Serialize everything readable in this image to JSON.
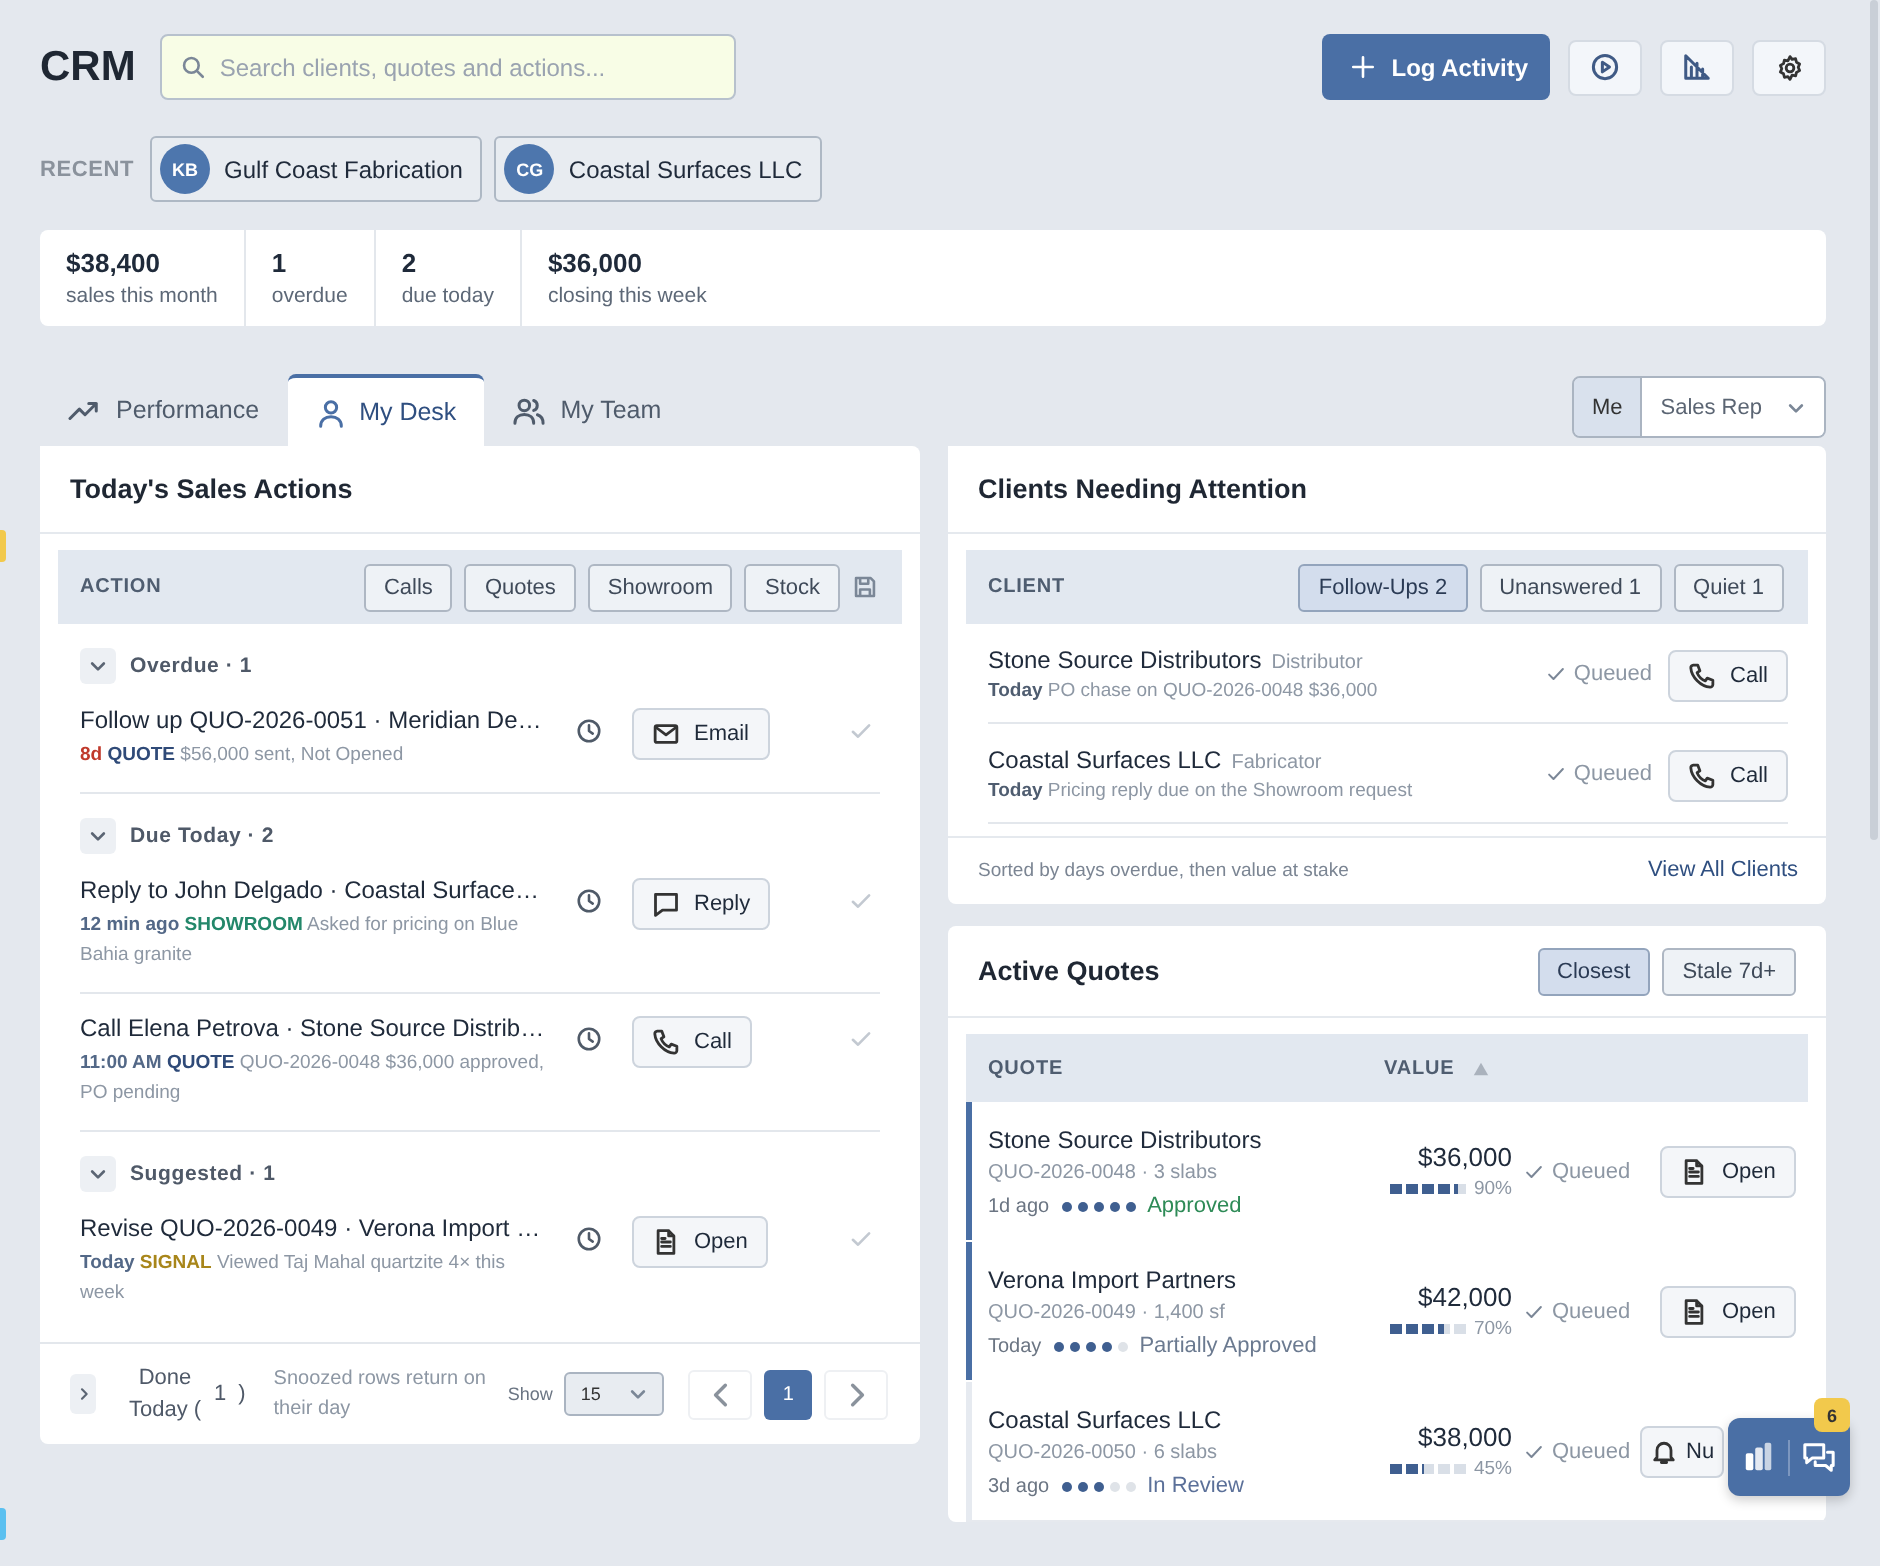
{
  "header": {
    "title": "CRM",
    "search": {
      "placeholder": "Search clients, quotes and actions..."
    },
    "primary_button": "Log Activity"
  },
  "recent": {
    "label": "RECENT",
    "items": [
      {
        "initials": "KB",
        "name": "Gulf Coast Fabrication"
      },
      {
        "initials": "CG",
        "name": "Coastal Surfaces LLC"
      }
    ]
  },
  "stats": [
    {
      "value": "$38,400",
      "label": "sales this month"
    },
    {
      "value": "1",
      "label": "overdue"
    },
    {
      "value": "2",
      "label": "due today"
    },
    {
      "value": "$36,000",
      "label": "closing this week"
    }
  ],
  "tabs": [
    {
      "label": "Performance",
      "selected": false
    },
    {
      "label": "My Desk",
      "selected": true
    },
    {
      "label": "My Team",
      "selected": false
    }
  ],
  "scope": {
    "toggle": {
      "label": "Me",
      "selected": true
    },
    "select": {
      "value": "Sales Rep"
    }
  },
  "sales_actions": {
    "title": "Today's Sales Actions",
    "column": "ACTION",
    "filters": [
      {
        "label": "Calls",
        "selected": false
      },
      {
        "label": "Quotes",
        "selected": false
      },
      {
        "label": "Showroom",
        "selected": false
      },
      {
        "label": "Stock",
        "selected": false
      }
    ],
    "groups": [
      {
        "label": "Overdue · 1",
        "expanded": true,
        "items": [
          {
            "title": "Follow up QUO-2026-0051 · Meridian De…",
            "when": "8d",
            "overdue": true,
            "tag": {
              "label": "QUOTE",
              "color": "#2f4a78"
            },
            "detail": "$56,000 sent, Not Opened",
            "action": {
              "kind": "email",
              "label": "Email"
            }
          }
        ]
      },
      {
        "label": "Due Today · 2",
        "expanded": true,
        "items": [
          {
            "title": "Reply to John Delgado · Coastal Surface…",
            "when": "12 min ago",
            "overdue": false,
            "tag": {
              "label": "SHOWROOM",
              "color": "#23876a"
            },
            "detail": "Asked for pricing on Blue Bahia granite",
            "action": {
              "kind": "reply",
              "label": "Reply"
            }
          },
          {
            "title": "Call Elena Petrova · Stone Source Distrib…",
            "when": "11:00 AM",
            "overdue": false,
            "tag": {
              "label": "QUOTE",
              "color": "#2f4a78"
            },
            "detail": "QUO-2026-0048 $36,000 approved, PO pending",
            "action": {
              "kind": "call",
              "label": "Call"
            }
          }
        ]
      },
      {
        "label": "Suggested · 1",
        "expanded": true,
        "items": [
          {
            "title": "Revise QUO-2026-0049 · Verona Import …",
            "when": "Today",
            "overdue": false,
            "tag": {
              "label": "SIGNAL",
              "color": "#a8861a"
            },
            "detail": "Viewed Taj Mahal quartzite 4× this week",
            "action": {
              "kind": "open",
              "label": "Open"
            }
          }
        ]
      }
    ],
    "footer": {
      "done": {
        "label": "Done Today (",
        "count": "1",
        "close": ")",
        "expanded": false
      },
      "note": "Snoozed rows return on their day",
      "show_label": "Show",
      "page_size": "15",
      "pages": [
        {
          "label": "1",
          "selected": true
        }
      ]
    }
  },
  "clients": {
    "title": "Clients Needing Attention",
    "column": "CLIENT",
    "filters": [
      {
        "label": "Follow-Ups 2",
        "selected": true
      },
      {
        "label": "Unanswered 1",
        "selected": false
      },
      {
        "label": "Quiet 1",
        "selected": false
      }
    ],
    "rows": [
      {
        "name": "Stone Source Distributors",
        "type": "Distributor",
        "when": "Today",
        "detail": "PO chase on QUO-2026-0048 $36,000",
        "status": "Queued",
        "action": {
          "kind": "call",
          "label": "Call"
        }
      },
      {
        "name": "Coastal Surfaces LLC",
        "type": "Fabricator",
        "when": "Today",
        "detail": "Pricing reply due on the Showroom request",
        "status": "Queued",
        "action": {
          "kind": "call",
          "label": "Call"
        }
      }
    ],
    "note": "Sorted by days overdue, then value at stake",
    "link": "View All Clients"
  },
  "quotes": {
    "title": "Active Quotes",
    "filters": [
      {
        "label": "Closest",
        "selected": true
      },
      {
        "label": "Stale 7d+",
        "selected": false
      }
    ],
    "columns": [
      "QUOTE",
      "VALUE"
    ],
    "rows": [
      {
        "client": "Stone Source Distributors",
        "ref": "QUO-2026-0048 · 3 slabs",
        "age": "1d ago",
        "stars": 5,
        "stage": {
          "label": "Approved",
          "color": "#2e8b57"
        },
        "value": "$36,000",
        "level": 0.9,
        "percent": "90%",
        "flagged": true,
        "status": "Queued",
        "action": {
          "kind": "open",
          "label": "Open"
        }
      },
      {
        "client": "Verona Import Partners",
        "ref": "QUO-2026-0049 · 1,400 sf",
        "age": "Today",
        "stars": 4,
        "stage": {
          "label": "Partially Approved",
          "color": "#6b7a90"
        },
        "value": "$42,000",
        "level": 0.7,
        "percent": "70%",
        "flagged": true,
        "status": "Queued",
        "action": {
          "kind": "open",
          "label": "Open"
        }
      },
      {
        "client": "Coastal Surfaces LLC",
        "ref": "QUO-2026-0050 · 6 slabs",
        "age": "3d ago",
        "stars": 3,
        "stage": {
          "label": "In Review",
          "color": "#5b7099"
        },
        "value": "$38,000",
        "level": 0.45,
        "percent": "45%",
        "flagged": false,
        "status": "Queued",
        "action": {
          "kind": "bell",
          "label": "Nu"
        }
      }
    ]
  },
  "assistant": {
    "badge": "6"
  }
}
